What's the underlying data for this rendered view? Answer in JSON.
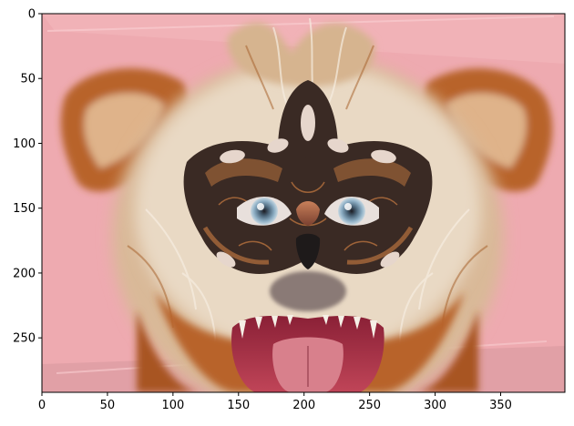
{
  "figure": {
    "image_subject": "dog-in-masquerade-mask",
    "colors": {
      "background_pink": "#eeaab0",
      "fur_light": "#e9d9c4",
      "fur_orange": "#b8642c",
      "mask_dark": "#3a2a24",
      "mask_copper": "#b8723e",
      "mouth_red": "#b0304a",
      "tongue_pink": "#d8808c",
      "eye_blue": "#7b9fb8"
    }
  },
  "chart_data": {
    "type": "image",
    "title": "",
    "xlabel": "",
    "ylabel": "",
    "xlim": [
      0,
      399
    ],
    "ylim": [
      292,
      0
    ],
    "x_ticks": [
      0,
      50,
      100,
      150,
      200,
      250,
      300,
      350
    ],
    "y_ticks": [
      0,
      50,
      100,
      150,
      200,
      250
    ],
    "x_tick_labels": [
      "0",
      "50",
      "100",
      "150",
      "200",
      "250",
      "300",
      "350"
    ],
    "y_tick_labels": [
      "0",
      "50",
      "100",
      "150",
      "200",
      "250"
    ],
    "grid": false
  }
}
